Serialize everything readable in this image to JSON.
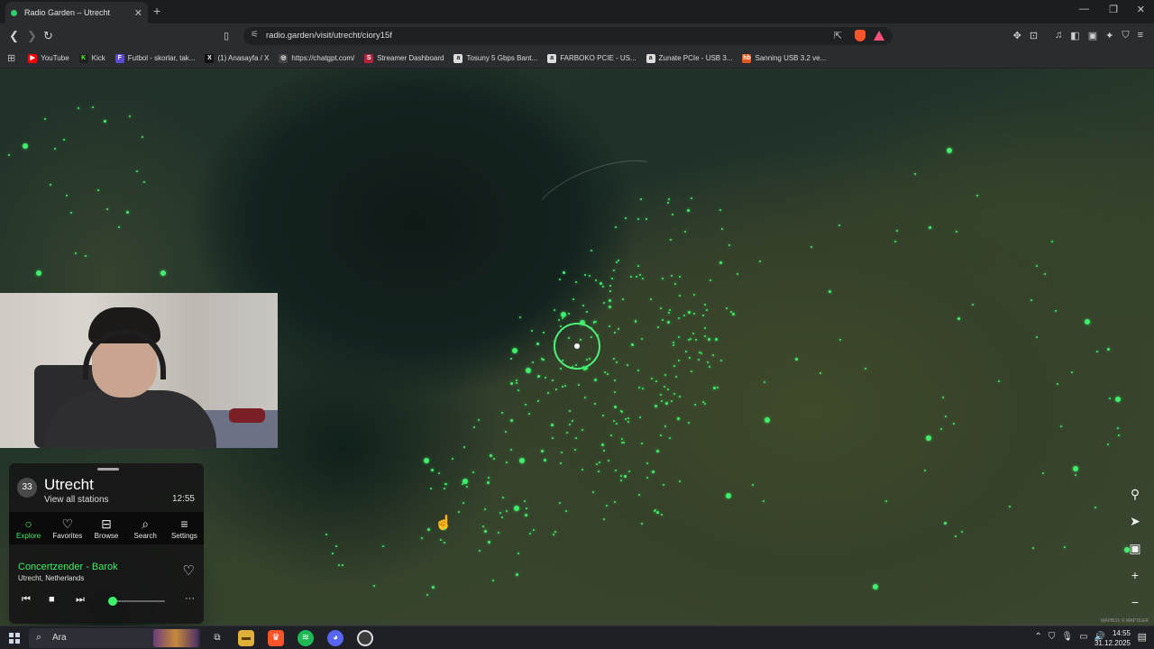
{
  "browser": {
    "tab_title": "Radio Garden – Utrecht",
    "url": "radio.garden/visit/utrecht/ciory15f",
    "bookmarks": [
      {
        "label": "YouTube",
        "color": "#ff0000",
        "glyph": "▶"
      },
      {
        "label": "Kick",
        "color": "#1f1f1f",
        "glyph": "K"
      },
      {
        "label": "Futbol - skorlar, tak...",
        "color": "#5a4ad1",
        "glyph": "F"
      },
      {
        "label": "(1) Anasayfa / X",
        "color": "#111111",
        "glyph": "X"
      },
      {
        "label": "https://chatgpt.com/",
        "color": "#444444",
        "glyph": "◎"
      },
      {
        "label": "Streamer Dashboard",
        "color": "#b4233b",
        "glyph": "S"
      },
      {
        "label": "Tosuny 5 Gbps Bant...",
        "color": "#dddddd",
        "glyph": "a"
      },
      {
        "label": "FARBOKO PCIE - US...",
        "color": "#dddddd",
        "glyph": "a"
      },
      {
        "label": "Zunate PCIe - USB 3...",
        "color": "#dddddd",
        "glyph": "a"
      },
      {
        "label": "Sanning USB 3.2 ve...",
        "color": "#e05a1e",
        "glyph": "hb"
      }
    ]
  },
  "map": {
    "accent_color": "#3ef06a",
    "attribution": "MAPBOX © MAPTILER"
  },
  "panel": {
    "station_count": "33",
    "city": "Utrecht",
    "view_all": "View all stations",
    "local_time": "12:55",
    "nav": [
      {
        "label": "Explore",
        "icon": "explore-icon",
        "active": true
      },
      {
        "label": "Favorites",
        "icon": "heart-icon",
        "active": false
      },
      {
        "label": "Browse",
        "icon": "map-icon",
        "active": false
      },
      {
        "label": "Search",
        "icon": "search-icon",
        "active": false
      },
      {
        "label": "Settings",
        "icon": "menu-icon",
        "active": false
      }
    ],
    "now_playing": {
      "station": "Concertzender - Barok",
      "location": "Utrecht, Netherlands"
    },
    "volume": 0.0
  },
  "taskbar": {
    "search_placeholder": "Ara",
    "time": "14:55",
    "date": "31.12.2025"
  }
}
